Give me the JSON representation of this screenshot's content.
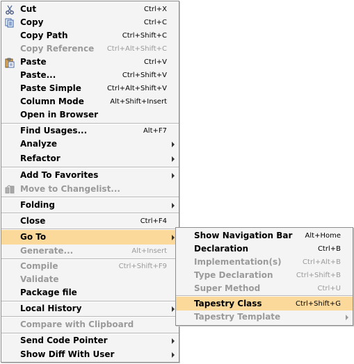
{
  "colors": {
    "menu_bg": "#f4f4f4",
    "highlight": "#fbd99b",
    "disabled": "#9a9a9a",
    "border": "#8c8c8c"
  },
  "context_menu": {
    "items": [
      {
        "label": "Cut",
        "shortcut": "Ctrl+X",
        "icon": "scissors-icon",
        "enabled": true
      },
      {
        "label": "Copy",
        "shortcut": "Ctrl+C",
        "icon": "copy-icon",
        "enabled": true
      },
      {
        "label": "Copy Path",
        "shortcut": "Ctrl+Shift+C",
        "enabled": true
      },
      {
        "label": "Copy Reference",
        "shortcut": "Ctrl+Alt+Shift+C",
        "enabled": false
      },
      {
        "label": "Paste",
        "shortcut": "Ctrl+V",
        "icon": "clipboard-icon",
        "enabled": true
      },
      {
        "label": "Paste...",
        "shortcut": "Ctrl+Shift+V",
        "enabled": true
      },
      {
        "label": "Paste Simple",
        "shortcut": "Ctrl+Alt+Shift+V",
        "enabled": true
      },
      {
        "label": "Column Mode",
        "shortcut": "Alt+Shift+Insert",
        "enabled": true
      },
      {
        "label": "Open in Browser",
        "shortcut": "",
        "enabled": true
      },
      {
        "label": "Find Usages...",
        "shortcut": "Alt+F7",
        "enabled": true
      },
      {
        "label": "Analyze",
        "submenu": true,
        "enabled": true
      },
      {
        "label": "Refactor",
        "submenu": true,
        "enabled": true
      },
      {
        "label": "Add To Favorites",
        "submenu": true,
        "enabled": true
      },
      {
        "label": "Move to Changelist...",
        "icon": "changelist-icon",
        "enabled": false
      },
      {
        "label": "Folding",
        "submenu": true,
        "enabled": true
      },
      {
        "label": "Close",
        "shortcut": "Ctrl+F4",
        "enabled": true
      },
      {
        "label": "Go To",
        "submenu": true,
        "enabled": true,
        "highlighted": true
      },
      {
        "label": "Generate...",
        "shortcut": "Alt+Insert",
        "enabled": false
      },
      {
        "label": "Compile",
        "shortcut": "Ctrl+Shift+F9",
        "enabled": false
      },
      {
        "label": "Validate",
        "enabled": false
      },
      {
        "label": "Package file",
        "enabled": true
      },
      {
        "label": "Local History",
        "submenu": true,
        "enabled": true
      },
      {
        "label": "Compare with Clipboard",
        "enabled": false
      },
      {
        "label": "Send Code Pointer",
        "submenu": true,
        "enabled": true
      },
      {
        "label": "Show Diff With User",
        "submenu": true,
        "enabled": true
      }
    ]
  },
  "goto_submenu": {
    "items": [
      {
        "label": "Show Navigation Bar",
        "shortcut": "Alt+Home",
        "enabled": true
      },
      {
        "label": "Declaration",
        "shortcut": "Ctrl+B",
        "enabled": true
      },
      {
        "label": "Implementation(s)",
        "shortcut": "Ctrl+Alt+B",
        "enabled": false
      },
      {
        "label": "Type Declaration",
        "shortcut": "Ctrl+Shift+B",
        "enabled": false
      },
      {
        "label": "Super Method",
        "shortcut": "Ctrl+U",
        "enabled": false
      },
      {
        "label": "Tapestry Class",
        "shortcut": "Ctrl+Shift+G",
        "enabled": true,
        "highlighted": true
      },
      {
        "label": "Tapestry Template",
        "submenu": true,
        "enabled": false
      }
    ]
  }
}
